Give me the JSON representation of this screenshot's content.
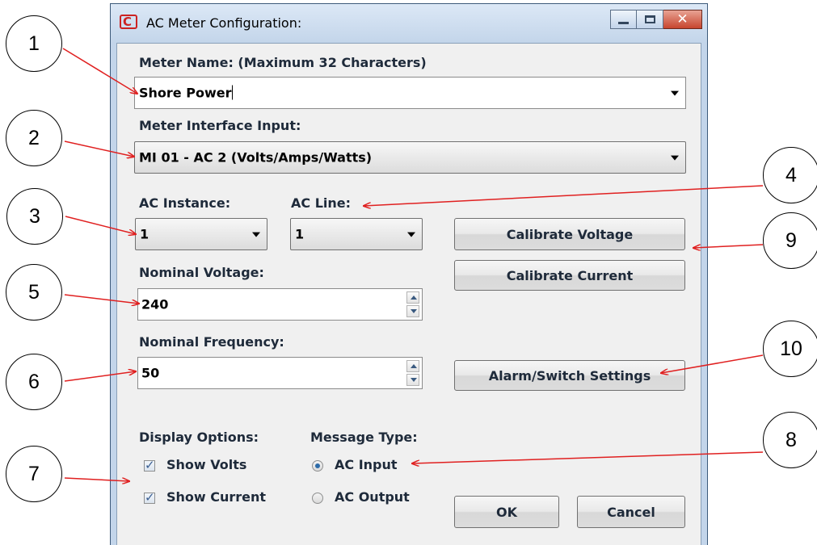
{
  "window": {
    "title": "AC Meter Configuration:",
    "minimize_glyph": "",
    "maximize_glyph": "",
    "close_glyph": "✕"
  },
  "form": {
    "meter_name_label": "Meter Name: (Maximum 32 Characters)",
    "meter_name_value": "Shore Power",
    "interface_label": "Meter Interface Input:",
    "interface_value": "MI 01 - AC 2 (Volts/Amps/Watts)",
    "instance_label": "AC Instance:",
    "instance_value": "1",
    "line_label": "AC Line:",
    "line_value": "1",
    "nominal_voltage_label": "Nominal Voltage:",
    "nominal_voltage_value": "240",
    "nominal_frequency_label": "Nominal Frequency:",
    "nominal_frequency_value": "50",
    "display_options_label": "Display Options:",
    "show_volts_label": "Show Volts",
    "show_volts_checked": true,
    "show_current_label": "Show Current",
    "show_current_checked": true,
    "message_type_label": "Message Type:",
    "ac_input_label": "AC Input",
    "ac_output_label": "AC Output",
    "message_type_selected": "AC Input"
  },
  "buttons": {
    "calibrate_voltage": "Calibrate Voltage",
    "calibrate_current": "Calibrate Current",
    "alarm_switch": "Alarm/Switch Settings",
    "ok": "OK",
    "cancel": "Cancel"
  },
  "callouts": [
    "1",
    "2",
    "3",
    "4",
    "5",
    "6",
    "7",
    "8",
    "9",
    "10"
  ],
  "colors": {
    "arrow": "#e02020",
    "frame": "#c3d5ea",
    "close_button": "#c7452e"
  }
}
